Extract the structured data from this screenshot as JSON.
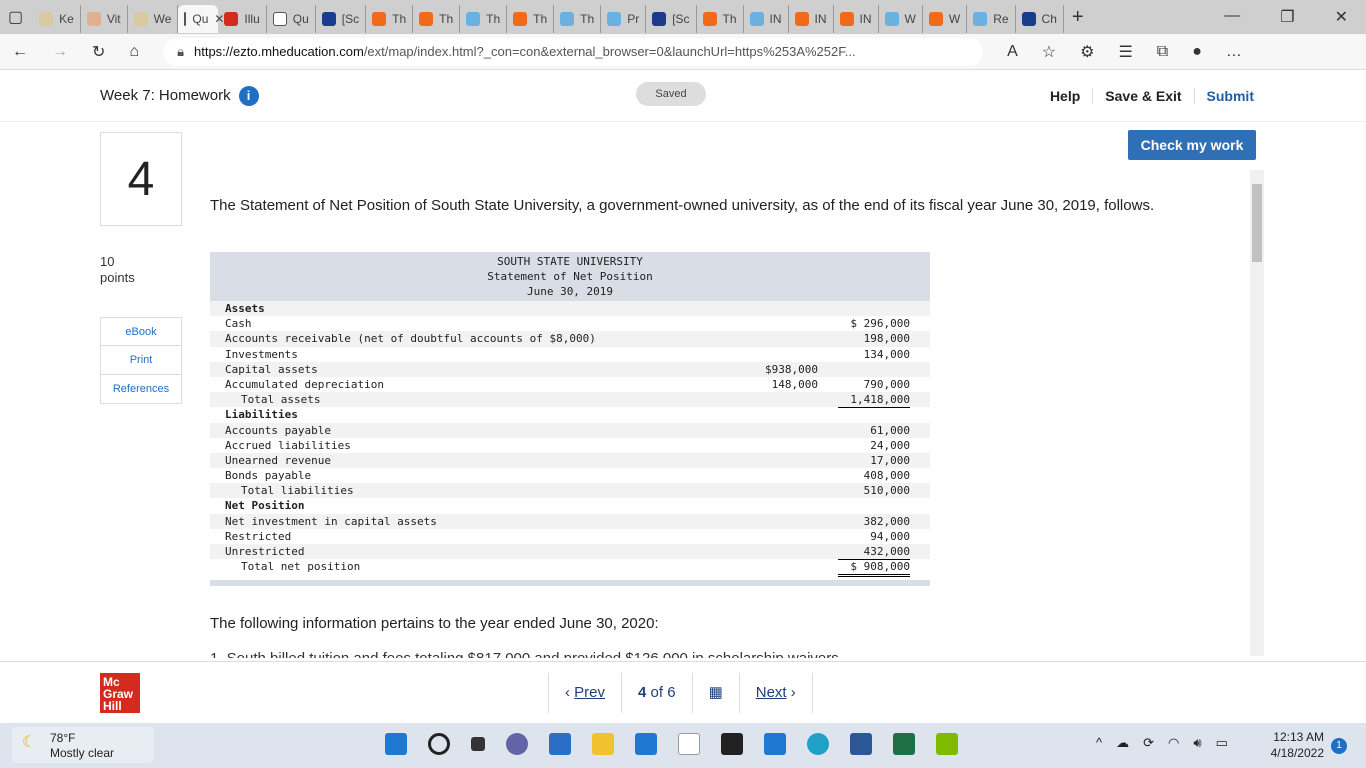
{
  "browser": {
    "tabs": [
      {
        "label": "Ke",
        "color": "#d8c9a0"
      },
      {
        "label": "Vit",
        "color": "#e0b090"
      },
      {
        "label": "We",
        "color": "#d8c9a0"
      },
      {
        "label": "Qu",
        "active": true,
        "color": "#ffffff"
      },
      {
        "label": "Illu",
        "color": "#d52b1e"
      },
      {
        "label": "Qu",
        "color": "#ffffff"
      },
      {
        "label": "[Sc",
        "color": "#1a3c8f"
      },
      {
        "label": "Th",
        "color": "#f06a1a"
      },
      {
        "label": "Th",
        "color": "#f06a1a"
      },
      {
        "label": "Th",
        "color": "#6ab0e0"
      },
      {
        "label": "Th",
        "color": "#f06a1a"
      },
      {
        "label": "Th",
        "color": "#6ab0e0"
      },
      {
        "label": "Pr",
        "color": "#6ab0e0"
      },
      {
        "label": "[Sc",
        "color": "#1a3c8f"
      },
      {
        "label": "Th",
        "color": "#f06a1a"
      },
      {
        "label": "IN",
        "color": "#6ab0e0"
      },
      {
        "label": "IN",
        "color": "#f06a1a"
      },
      {
        "label": "IN",
        "color": "#f06a1a"
      },
      {
        "label": "W",
        "color": "#6ab0e0"
      },
      {
        "label": "W",
        "color": "#f06a1a"
      },
      {
        "label": "Re",
        "color": "#6ab0e0"
      },
      {
        "label": "Ch",
        "color": "#1a3c8f"
      }
    ],
    "url_domain": "https://ezto.mheducation.com",
    "url_rest": "/ext/map/index.html?_con=con&external_browser=0&launchUrl=https%253A%252F..."
  },
  "header": {
    "title": "Week 7: Homework",
    "saved": "Saved",
    "help": "Help",
    "save_exit": "Save & Exit",
    "submit": "Submit"
  },
  "check_button": "Check my work",
  "question": {
    "number": "4",
    "points_value": "10",
    "points_label": "points",
    "side": [
      "eBook",
      "Print",
      "References"
    ],
    "text": "The Statement of Net Position of South State University, a government-owned university, as of the end of its fiscal year June 30, 2019, follows.",
    "following": "The following information pertains to the year ended June 30, 2020:",
    "cut_line": "1. South billed tuition and fees totaling $817,000 and provided $126,000 in scholarship waivers"
  },
  "statement": {
    "heading": [
      "SOUTH STATE UNIVERSITY",
      "Statement of Net Position",
      "June 30, 2019"
    ],
    "rows": [
      {
        "label": "Assets",
        "bold": true
      },
      {
        "label": "Cash",
        "c2": "$ 296,000"
      },
      {
        "label": "Accounts receivable (net of doubtful accounts of $8,000)",
        "c2": "198,000"
      },
      {
        "label": "Investments",
        "c2": "134,000"
      },
      {
        "label": "Capital assets",
        "c1": "$938,000"
      },
      {
        "label": "Accumulated depreciation",
        "c1": "148,000",
        "c2": "790,000",
        "u1": true,
        "u2": true
      },
      {
        "label": "Total assets",
        "c2": "1,418,000",
        "ind": true,
        "u2": true
      },
      {
        "label": "Liabilities",
        "bold": true
      },
      {
        "label": "Accounts payable",
        "c2": "61,000"
      },
      {
        "label": "Accrued liabilities",
        "c2": "24,000"
      },
      {
        "label": "Unearned revenue",
        "c2": "17,000"
      },
      {
        "label": "Bonds payable",
        "c2": "408,000",
        "u2": true
      },
      {
        "label": "Total liabilities",
        "c2": "510,000",
        "ind": true
      },
      {
        "label": "Net Position",
        "bold": true
      },
      {
        "label": "Net investment in capital assets",
        "c2": "382,000"
      },
      {
        "label": "Restricted",
        "c2": "94,000"
      },
      {
        "label": "Unrestricted",
        "c2": "432,000",
        "u2": true
      },
      {
        "label": "Total net position",
        "c2": "$ 908,000",
        "ind": true,
        "d2": true
      }
    ]
  },
  "footer": {
    "prev": "Prev",
    "page": "4",
    "of": "of",
    "total": "6",
    "next": "Next",
    "logo": "Mc Graw Hill"
  },
  "taskbar": {
    "temp": "78°F",
    "weather": "Mostly clear",
    "time": "12:13 AM",
    "date": "4/18/2022",
    "notifications": "1"
  }
}
